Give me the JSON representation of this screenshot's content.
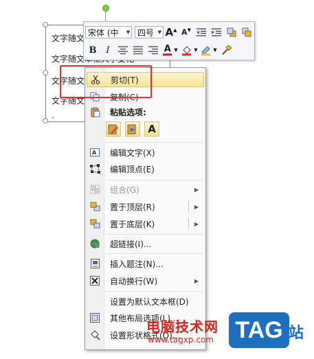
{
  "textbox": {
    "lines": [
      "文字随文",
      "文字随文本框大小变化",
      "文字随文",
      "文字随文",
      "."
    ]
  },
  "mini_toolbar": {
    "font_name": "宋体 (中",
    "font_size": "四号",
    "grow_font_icon": "A",
    "shrink_font_icon": "A",
    "bold": "B",
    "italic": "I",
    "font_color_glyph": "A",
    "font_color": "#d32222",
    "highlight_color": "#e23a2a",
    "outline_color": "#e8c23a"
  },
  "context_menu": {
    "items": [
      {
        "label": "剪切(T)",
        "icon": "scissors-icon",
        "highlighted": true
      },
      {
        "label": "复制(C)",
        "icon": "copy-icon"
      },
      {
        "label": "粘贴选项:",
        "icon": "paste-icon",
        "bold": true
      },
      {
        "label": "编辑文字(X)",
        "icon": "edit-text-icon"
      },
      {
        "label": "编辑顶点(E)",
        "icon": "edit-points-icon"
      },
      {
        "label": "组合(G)",
        "icon": "group-icon",
        "disabled": true,
        "submenu": true
      },
      {
        "label": "置于顶层(R)",
        "icon": "bring-front-icon",
        "submenu": true
      },
      {
        "label": "置于底层(K)",
        "icon": "send-back-icon",
        "submenu": true
      },
      {
        "label": "超链接(I)...",
        "icon": "hyperlink-icon"
      },
      {
        "label": "插入题注(N)...",
        "icon": "insert-caption-icon"
      },
      {
        "label": "自动换行(W)",
        "icon": "text-wrap-icon",
        "submenu": true
      },
      {
        "label": "设置为默认文本框(D)"
      },
      {
        "label": "其他布局选项(L)...",
        "icon": "layout-options-icon"
      },
      {
        "label": "设置形状格式(O)...",
        "icon": "format-shape-icon"
      }
    ],
    "paste_options": [
      "A"
    ]
  },
  "watermark": {
    "title": "电脑技术网",
    "url": "www.tagxp.com",
    "badge": "TAG",
    "suffix": "站"
  }
}
